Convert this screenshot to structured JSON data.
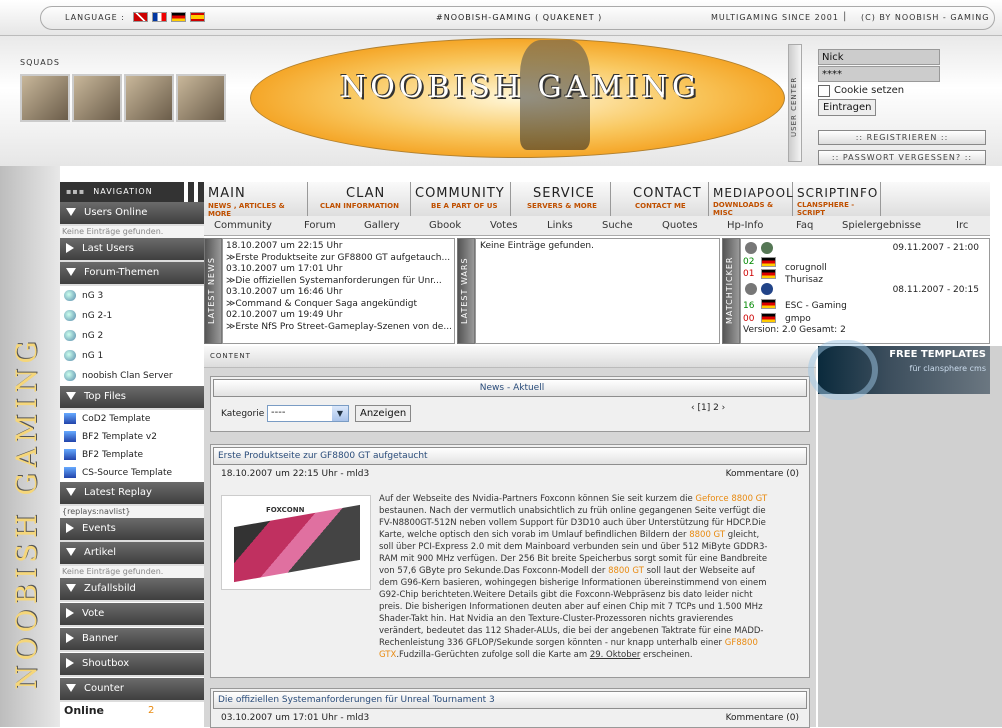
{
  "topbar": {
    "language_label": "LANGUAGE :",
    "flags": [
      "uk-flag-icon",
      "fr-flag-icon",
      "de-flag-icon",
      "es-flag-icon"
    ],
    "channel": "#NOOBISH-GAMING ( QUAKENET )",
    "tagline": "MULTIGAMING SINCE 2001",
    "separator": "|",
    "copyright": "(C) BY NOOBISH - GAMING"
  },
  "header": {
    "squads_label": "SQUADS",
    "logo_text": "NOOBISH GAMING",
    "user_center_label": "USER CENTER",
    "login": {
      "nick_value": "Nick",
      "password_value": "****",
      "cookie_label": "Cookie setzen",
      "submit_label": "Eintragen"
    },
    "register_label": ":: REGISTRIEREN ::",
    "forgot_label": ":: PASSWORT VERGESSEN? ::"
  },
  "side_logo_text": "NOOBISH GAMING",
  "nav": {
    "title": "NAVIGATION",
    "users_online": "Users Online",
    "users_online_empty": "Keine Einträge gefunden.",
    "last_users": "Last Users",
    "forum_themen": "Forum-Themen",
    "forum_items": [
      "nG 3",
      "nG 2-1",
      "nG 2",
      "nG 1",
      "noobish Clan Server"
    ],
    "top_files": "Top Files",
    "file_items": [
      "CoD2 Template",
      "BF2 Template v2",
      "BF2 Template",
      "CS-Source Template"
    ],
    "latest_replay": "Latest Replay",
    "replay_placeholder": "{replays:navlist}",
    "events": "Events",
    "artikel": "Artikel",
    "artikel_empty": "Keine Einträge gefunden.",
    "zufallsbild": "Zufallsbild",
    "vote": "Vote",
    "banner": "Banner",
    "shoutbox": "Shoutbox",
    "counter": "Counter",
    "online_label": "Online",
    "online_count": "2"
  },
  "menu": {
    "items": [
      {
        "big": "MAIN",
        "sub": "NEWS , ARTICLES & MORE"
      },
      {
        "big": "CLAN",
        "sub": "CLAN INFORMATION"
      },
      {
        "big": "COMMUNITY",
        "sub": "BE A PART OF US"
      },
      {
        "big": "SERVICE",
        "sub": "SERVERS & MORE"
      },
      {
        "big": "CONTACT",
        "sub": "CONTACT ME"
      },
      {
        "big": "MEDIAPOOL",
        "sub": "DOWNLOADS & MISC"
      },
      {
        "big": "SCRIPTINFO",
        "sub": "CLANSPHERE - SCRIPT"
      }
    ],
    "sub_items": [
      "Community",
      "Forum",
      "Gallery",
      "Gbook",
      "Votes",
      "Links",
      "Suche",
      "Quotes",
      "Hp-Info",
      "Faq",
      "Spielergebnisse",
      "Irc"
    ]
  },
  "latest_news": {
    "label": "LATEST NEWS",
    "items": [
      {
        "date": "18.10.2007 um 22:15 Uhr",
        "title": "Erste Produktseite zur GF8800 GT aufgetauch..."
      },
      {
        "date": "03.10.2007 um 17:01 Uhr",
        "title": "Die offiziellen Systemanforderungen für Unr..."
      },
      {
        "date": "03.10.2007 um 16:46 Uhr",
        "title": "Command & Conquer Saga angekündigt"
      },
      {
        "date": "02.10.2007 um 19:49 Uhr",
        "title": "Erste NfS Pro Street-Gameplay-Szenen von de..."
      }
    ]
  },
  "latest_wars": {
    "label": "LATEST WARS",
    "empty": "Keine Einträge gefunden."
  },
  "matchticker": {
    "label": "MATCHTICKER",
    "matches": [
      {
        "date": "09.11.2007 - 21:00",
        "score1": "02",
        "score2": "01",
        "team1": "corugnoll",
        "team2": "Thurisaz"
      },
      {
        "date": "08.11.2007 - 20:15",
        "score1": "16",
        "score2": "00",
        "team1": "ESC - Gaming",
        "team2": "gmpo"
      }
    ],
    "version": "Version: 2.0 Gesamt: 2"
  },
  "content": {
    "label": "CONTENT",
    "news_panel_title": "News - Aktuell",
    "kategorie_label": "Kategorie",
    "kategorie_value": "----",
    "show_button": "Anzeigen",
    "pagination": "‹ [1] 2 ›",
    "article1": {
      "title": "Erste Produktseite zur GF8800 GT aufgetaucht",
      "meta": "18.10.2007 um 22:15 Uhr - mld3",
      "comments": "Kommentare (0)",
      "image_brand": "FOXCONN",
      "p1": "Auf der Webseite des Nvidia-Partners Foxconn können Sie seit kurzem die ",
      "h1": "Geforce 8800 GT",
      "p2": " bestaunen. Nach der vermutlich unabsichtlich zu früh online gegangenen Seite verfügt die FV-N8800GT-512N neben vollem Support für D3D10 auch über Unterstützung für HDCP.Die Karte, welche optisch den sich vorab im Umlauf befindlichen Bildern der ",
      "h2": "8800 GT",
      "p3": " gleicht, soll über PCI-Express 2.0 mit dem Mainboard verbunden sein und über 512 MiByte GDDR3-RAM mit 900 MHz verfügen. Der 256 Bit breite Speicherbus sorgt somit für eine Bandbreite von 57,6 GByte pro Sekunde.Das Foxconn-Modell der ",
      "h3": "8800 GT",
      "p4": " soll laut der Webseite auf dem G96-Kern basieren, wohingegen bisherige Informationen übereinstimmend von einem G92-Chip berichteten.Weitere Details gibt die Foxconn-Webpräsenz bis dato leider nicht preis. Die bisherigen Informationen deuten aber auf einen Chip mit 7 TCPs und 1.500 MHz Shader-Takt hin. Hat Nvidia an den Texture-Cluster-Prozessoren nichts gravierendes verändert, bedeutet das 112 Shader-ALUs, die bei der angebenen Taktrate für eine MADD-Rechenleistung 336 GFLOP/Sekunde sorgen könnten - nur knapp unterhalb einer ",
      "h4": "GF8800 GTX",
      "p5": ".Fudzilla-Gerüchten zufolge soll die Karte am ",
      "link": "29. Oktober",
      "p6": " erscheinen."
    },
    "article2": {
      "title": "Die offiziellen Systemanforderungen für Unreal Tournament 3",
      "meta": "03.10.2007 um 17:01 Uhr - mld3",
      "comments": "Kommentare (0)"
    }
  },
  "ad": {
    "title": "FREE TEMPLATES",
    "subtitle": "für clansphere cms"
  },
  "colors": {
    "accent_orange": "#e88a10",
    "nav_dark": "#4a4a4a",
    "link_blue": "#2a4c7a"
  }
}
